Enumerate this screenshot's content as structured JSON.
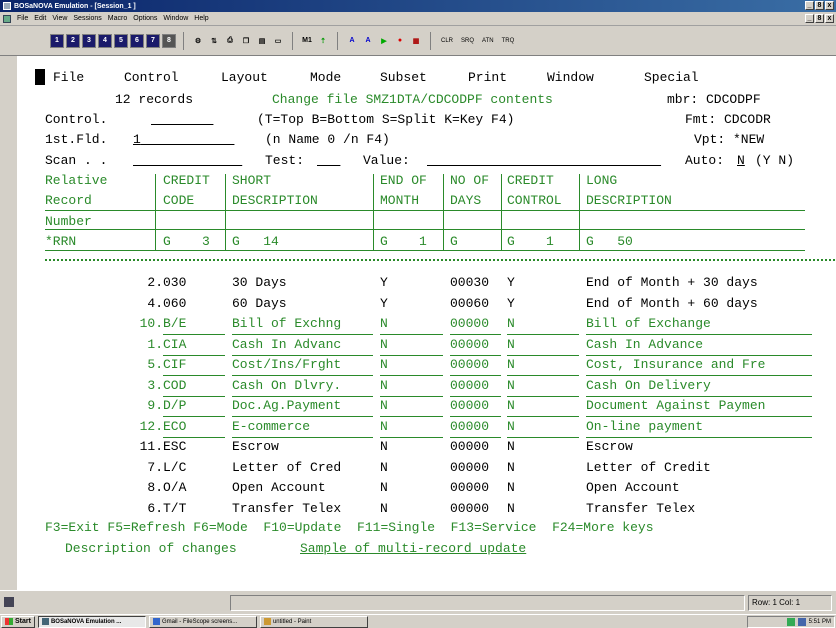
{
  "window": {
    "title": "BOSaNOVA Emulation - [Session_1 ]",
    "minimize": "_",
    "maximize": "8",
    "close": "x"
  },
  "menu": [
    "File",
    "Edit",
    "View",
    "Sessions",
    "Macro",
    "Options",
    "Window",
    "Help"
  ],
  "toolbar": {
    "session_buttons": [
      "1",
      "2",
      "3",
      "4",
      "5",
      "6",
      "7",
      "8"
    ],
    "macro_label": "M1",
    "text_buttons": [
      "CLR",
      "SRQ",
      "ATN",
      "TRQ"
    ]
  },
  "screen": {
    "menu": [
      "File",
      "Control",
      "Layout",
      "Mode",
      "Subset",
      "Print",
      "Window",
      "Special"
    ],
    "records": "12 records",
    "heading": "Change file SMZ1DTA/CDCODPF contents",
    "mbr": "mbr: CDCODPF",
    "control_label": "Control.",
    "control_hint": "(T=Top B=Bottom S=Split K=Key F4)",
    "fmt": "Fmt: CDCODR",
    "fld_label": "1st.Fld.",
    "fld_value": "1",
    "fld_hint": "(n Name 0 /n F4)",
    "vpt": "Vpt: *NEW",
    "scan_label": "Scan . .",
    "test_label": "Test:",
    "value_label": "Value:",
    "auto_label": "Auto:",
    "auto_value": "N",
    "auto_hint": "(Y N)",
    "col_headers": [
      [
        "Relative",
        "Record",
        "Number"
      ],
      [
        "CREDIT",
        "CODE",
        ""
      ],
      [
        "SHORT",
        "DESCRIPTION",
        ""
      ],
      [
        "END OF",
        "MONTH",
        ""
      ],
      [
        "NO OF",
        "DAYS",
        ""
      ],
      [
        "CREDIT",
        "CONTROL",
        ""
      ],
      [
        "LONG",
        "DESCRIPTION",
        ""
      ]
    ],
    "format_row": [
      "*RRN",
      "G    3",
      "G   14",
      "G    1",
      "G",
      "G    1",
      "G   50"
    ],
    "rows": [
      {
        "rrn": "2.",
        "code": "030",
        "short": "30 Days",
        "eom": "Y",
        "days": "00030",
        "ctl": "Y",
        "long": "End of Month + 30 days",
        "changed": false
      },
      {
        "rrn": "4.",
        "code": "060",
        "short": "60 Days",
        "eom": "Y",
        "days": "00060",
        "ctl": "Y",
        "long": "End of Month + 60 days",
        "changed": false
      },
      {
        "rrn": "10.",
        "code": "B/E",
        "short": "Bill of Exchng",
        "eom": "N",
        "days": "00000",
        "ctl": "N",
        "long": "Bill of Exchange",
        "changed": true
      },
      {
        "rrn": "1.",
        "code": "CIA",
        "short": "Cash In Advanc",
        "eom": "N",
        "days": "00000",
        "ctl": "N",
        "long": "Cash In Advance",
        "changed": true
      },
      {
        "rrn": "5.",
        "code": "CIF",
        "short": "Cost/Ins/Frght",
        "eom": "N",
        "days": "00000",
        "ctl": "N",
        "long": "Cost, Insurance and Fre",
        "changed": true
      },
      {
        "rrn": "3.",
        "code": "COD",
        "short": "Cash On Dlvry.",
        "eom": "N",
        "days": "00000",
        "ctl": "N",
        "long": "Cash On Delivery",
        "changed": true
      },
      {
        "rrn": "9.",
        "code": "D/P",
        "short": "Doc.Ag.Payment",
        "eom": "N",
        "days": "00000",
        "ctl": "N",
        "long": "Document Against Paymen",
        "changed": true
      },
      {
        "rrn": "12.",
        "code": "ECO",
        "short": "E-commerce",
        "eom": "N",
        "days": "00000",
        "ctl": "N",
        "long": "On-line payment",
        "changed": true
      },
      {
        "rrn": "11.",
        "code": "ESC",
        "short": "Escrow",
        "eom": "N",
        "days": "00000",
        "ctl": "N",
        "long": "Escrow",
        "changed": false
      },
      {
        "rrn": "7.",
        "code": "L/C",
        "short": "Letter of Cred",
        "eom": "N",
        "days": "00000",
        "ctl": "N",
        "long": "Letter of Credit",
        "changed": false
      },
      {
        "rrn": "8.",
        "code": "O/A",
        "short": "Open Account",
        "eom": "N",
        "days": "00000",
        "ctl": "N",
        "long": "Open Account",
        "changed": false
      },
      {
        "rrn": "6.",
        "code": "T/T",
        "short": "Transfer Telex",
        "eom": "N",
        "days": "00000",
        "ctl": "N",
        "long": "Transfer Telex",
        "changed": false
      }
    ],
    "fkeys": "F3=Exit F5=Refresh F6=Mode  F10=Update  F11=Single  F13=Service  F24=More keys",
    "desc_label": "Description of changes",
    "desc_value": "Sample of multi-record update"
  },
  "status": {
    "position": "Row: 1  Col: 1"
  },
  "taskbar": {
    "start": "Start",
    "tasks": [
      "BOSaNOVA Emulation ...",
      "Gmail - FileScope screens...",
      "untitled - Paint"
    ],
    "clock": "5:51 PM"
  },
  "colors": {
    "field_green": "#2a8a2a",
    "title_blue": "#0a246a"
  }
}
